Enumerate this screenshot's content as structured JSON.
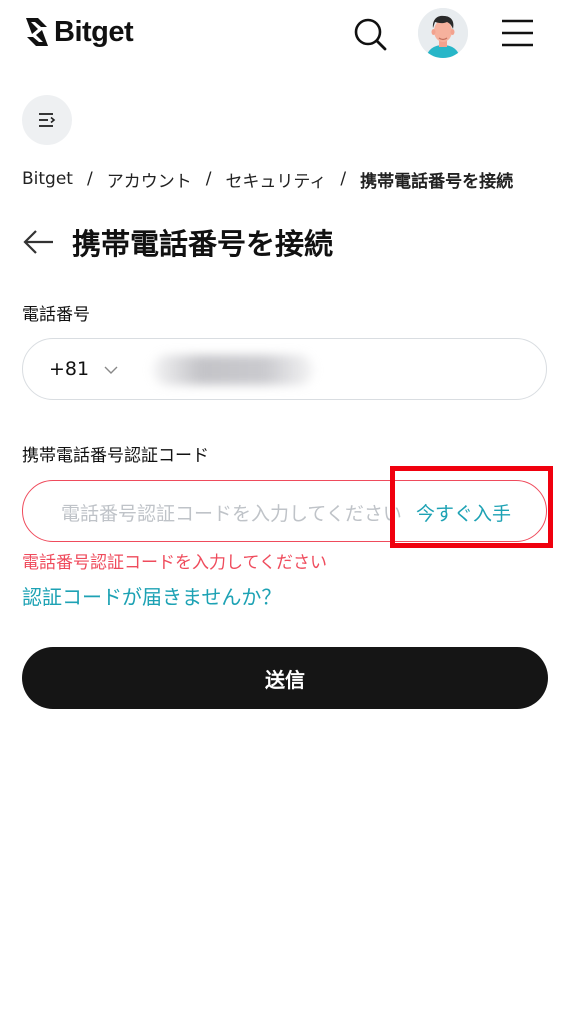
{
  "header": {
    "logo_text": "Bitget"
  },
  "breadcrumb": {
    "items": [
      "Bitget",
      "アカウント",
      "セキュリティ"
    ],
    "current": "携帯電話番号を接続",
    "separator": "/"
  },
  "page": {
    "title": "携帯電話番号を接続"
  },
  "phone": {
    "label": "電話番号",
    "country_code": "+81"
  },
  "verification": {
    "label": "携帯電話番号認証コード",
    "placeholder": "電話番号認証コードを入力してください",
    "get_code_label": "今すぐ入手",
    "error": "電話番号認証コードを入力してください",
    "help_link": "認証コードが届きませんか？"
  },
  "actions": {
    "submit_label": "送信"
  },
  "colors": {
    "accent": "#1da2b4",
    "error": "#ef4b5c",
    "highlight": "#f0000e",
    "button": "#151515"
  }
}
